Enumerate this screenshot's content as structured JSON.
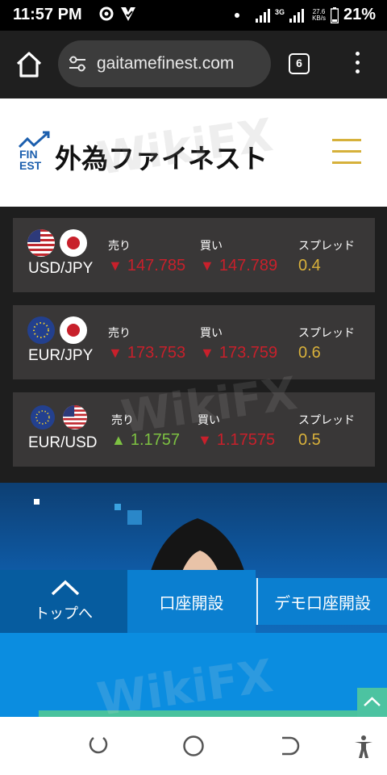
{
  "status_bar": {
    "time": "11:57 PM",
    "network": "3G",
    "speed_value": "27.6",
    "speed_unit": "KB/s",
    "battery": "21%"
  },
  "browser": {
    "url": "gaitamefinest.com",
    "tab_count": "6"
  },
  "site": {
    "logo_mark_line1": "FIN",
    "logo_mark_line2": "EST",
    "logo_text": "外為ファイネスト"
  },
  "labels": {
    "sell": "売り",
    "buy": "買い",
    "spread": "スプレッド"
  },
  "rates": [
    {
      "pair": "USD/JPY",
      "sell": "147.785",
      "sell_dir": "down",
      "buy": "147.789",
      "buy_dir": "down",
      "spread": "0.4"
    },
    {
      "pair": "EUR/JPY",
      "sell": "173.753",
      "sell_dir": "down",
      "buy": "173.759",
      "buy_dir": "down",
      "spread": "0.6"
    },
    {
      "pair": "EUR/USD",
      "sell": "1.1757",
      "sell_dir": "up",
      "buy": "1.17575",
      "buy_dir": "down",
      "spread": "0.5"
    }
  ],
  "footer_nav": {
    "top": "トップへ",
    "open_account": "口座開設",
    "demo_account": "デモ口座開設"
  },
  "watermark": "WikiFX",
  "colors": {
    "down": "#c8202b",
    "up": "#7dc142",
    "spread": "#d9b13b",
    "accent_gold": "#d6b13b",
    "nav_blue": "#0b7fd0"
  }
}
